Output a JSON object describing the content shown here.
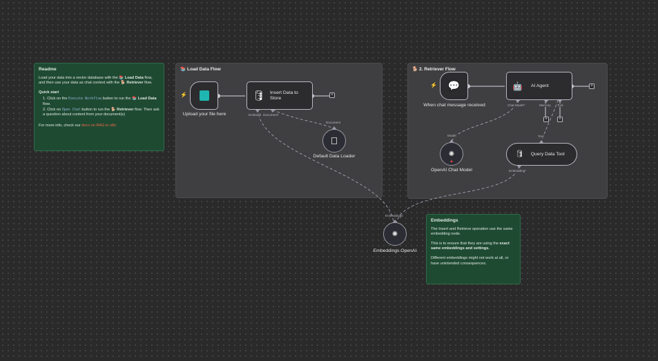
{
  "readme": {
    "title": "Readme",
    "intro_a": "Load your data into a vector database with the 📚 ",
    "intro_b": "Load Data",
    "intro_c": " flow, and then use your data as chat context with the 🐕 ",
    "intro_d": "Retriever",
    "intro_e": " flow.",
    "quick_start": "Quick start",
    "step1_a": "Click on the ",
    "step1_code": "Execute Workflow",
    "step1_b": " button to run the 📚 ",
    "step1_c": "Load Data",
    "step1_d": " flow.",
    "step2_a": "Click on ",
    "step2_code": "Open Chat",
    "step2_b": " button to run the 🐕 ",
    "step2_c": "Retriever",
    "step2_d": " flow. Then ask a question about content from your document(s)",
    "more_a": "For more info, check our ",
    "more_link": "docs on RAG in n8n"
  },
  "groups": {
    "load": "📚 Load Data Flow",
    "retriever": "🐕 2. Retriever Flow"
  },
  "nodes": {
    "upload": "Upload your file here",
    "insert": "Insert Data to Store",
    "loader": "Default Data Loader",
    "chat_trigger": "When chat message received",
    "agent": "AI Agent",
    "chat_model": "OpenAI Chat Model",
    "query_tool": "Query Data Tool",
    "embeddings": "Embeddings OpenAI"
  },
  "ports": {
    "embedding": "Embeddi",
    "document": "Document*",
    "document_in": "Document",
    "chat_model": "Chat Model*",
    "memory": "Memory",
    "tool": "Tool",
    "model": "Model",
    "tool_in": "Tool",
    "embedding_star": "Embedding*",
    "embeddings_in": "Embeddings"
  },
  "embeddings_note": {
    "title": "Embeddings",
    "p1": "The Insert and Retrieve operation use the same embedding node.",
    "p2_a": "This is to ensure that they are using the ",
    "p2_b": "exact same embeddings and settings.",
    "p3": "Different embeddings might not work at all, or have unintended consequences."
  },
  "colors": {
    "sticky": "#1f4a32",
    "group": "#3f3f41",
    "trigger": "#f0573b",
    "link": "#f06a4a",
    "upload_icon": "#1fb5b0"
  }
}
